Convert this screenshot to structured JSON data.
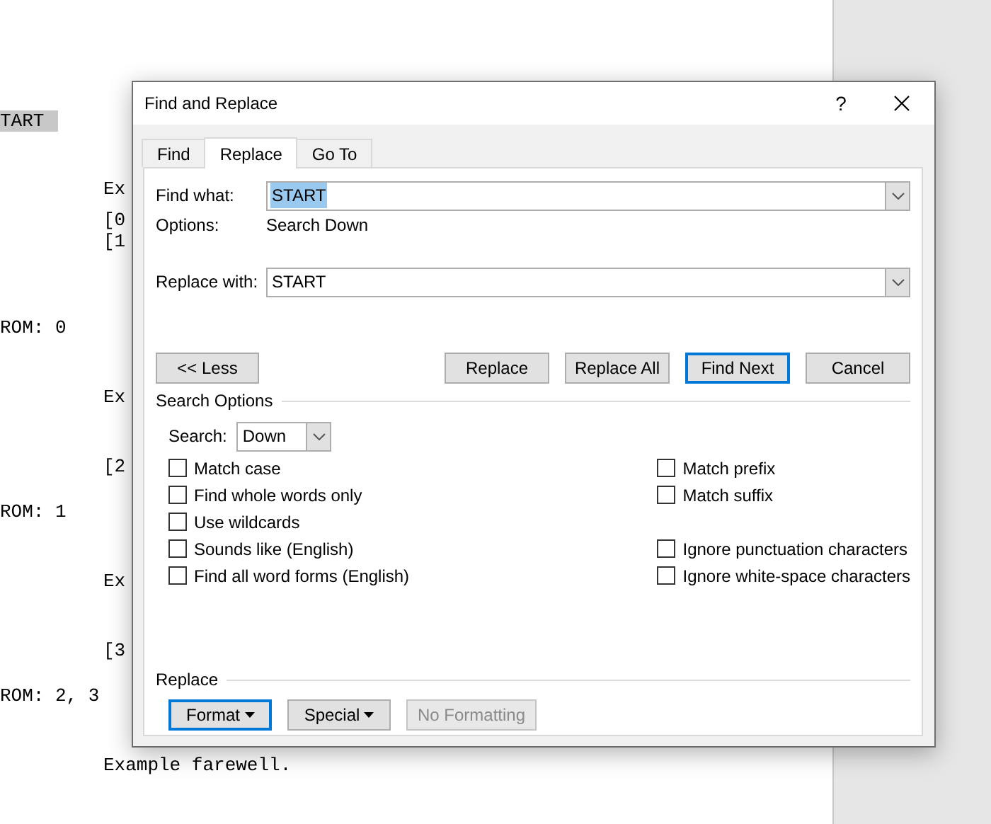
{
  "document": {
    "lines": [
      {
        "text": "TART",
        "kind": "margin",
        "highlighted": true
      },
      {
        "text": "Ex",
        "kind": "indent",
        "highlighted": false
      },
      {
        "text": "[0",
        "kind": "indent",
        "highlighted": false
      },
      {
        "text": "[1",
        "kind": "indent",
        "highlighted": false
      },
      {
        "text": "ROM: 0",
        "kind": "margin",
        "highlighted": false
      },
      {
        "text": "Ex",
        "kind": "indent",
        "highlighted": false
      },
      {
        "text": "[2",
        "kind": "indent",
        "highlighted": false
      },
      {
        "text": "ROM: 1",
        "kind": "margin",
        "highlighted": false
      },
      {
        "text": "Ex",
        "kind": "indent",
        "highlighted": false
      },
      {
        "text": "[3",
        "kind": "indent",
        "highlighted": false
      },
      {
        "text": "ROM: 2, 3",
        "kind": "margin",
        "highlighted": false
      },
      {
        "text": "Example farewell.",
        "kind": "indent",
        "highlighted": false
      }
    ]
  },
  "dialog": {
    "title": "Find and Replace",
    "help": "?",
    "tabs": [
      {
        "label": "Find",
        "selected": false
      },
      {
        "label": "Replace",
        "selected": true
      },
      {
        "label": "Go To",
        "selected": false
      }
    ],
    "find_what": {
      "label": "Find what:",
      "value": "START",
      "selected": true
    },
    "options": {
      "label": "Options:",
      "value": "Search Down"
    },
    "replace_with": {
      "label": "Replace with:",
      "value": "START",
      "selected": false
    },
    "less_button": {
      "label": "<< Less",
      "focused": false
    },
    "action_buttons": [
      {
        "label": "Replace",
        "focused": false
      },
      {
        "label": "Replace All",
        "focused": false
      },
      {
        "label": "Find Next",
        "focused": true
      },
      {
        "label": "Cancel",
        "focused": false
      }
    ],
    "search_options": {
      "title": "Search Options",
      "search_label": "Search:",
      "search_value": "Down",
      "left": [
        {
          "label": "Match case",
          "checked": false
        },
        {
          "label": "Find whole words only",
          "checked": false
        },
        {
          "label": "Use wildcards",
          "checked": false
        },
        {
          "label": "Sounds like (English)",
          "checked": false
        },
        {
          "label": "Find all word forms (English)",
          "checked": false
        }
      ],
      "right_groups": [
        [
          {
            "label": "Match prefix",
            "checked": false
          },
          {
            "label": "Match suffix",
            "checked": false
          }
        ],
        [
          {
            "label": "Ignore punctuation characters",
            "checked": false
          },
          {
            "label": "Ignore white-space characters",
            "checked": false
          }
        ]
      ]
    },
    "replace": {
      "title": "Replace",
      "buttons": [
        {
          "label": "Format",
          "menu": true,
          "focused": true,
          "disabled": false
        },
        {
          "label": "Special",
          "menu": true,
          "focused": false,
          "disabled": false
        },
        {
          "label": "No Formatting",
          "menu": false,
          "focused": false,
          "disabled": true
        }
      ]
    }
  }
}
